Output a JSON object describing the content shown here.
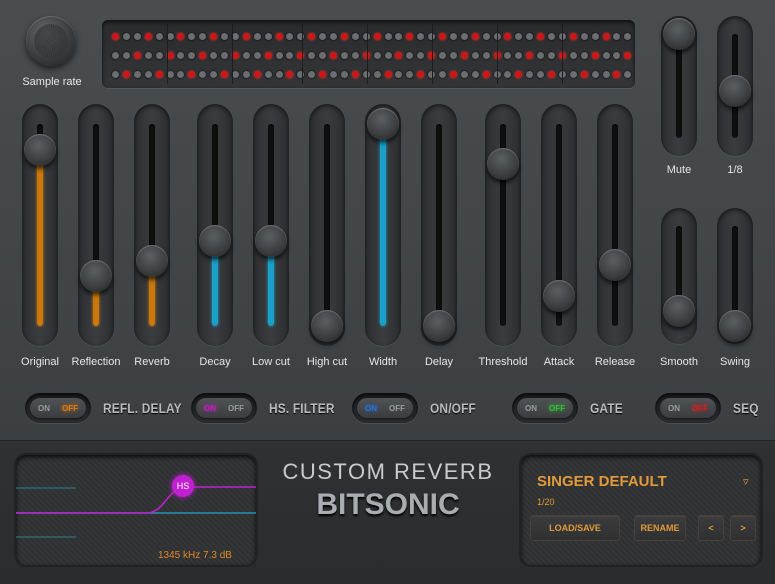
{
  "knob": {
    "label": "Sample rate"
  },
  "sliders": [
    {
      "id": "original",
      "label": "Original",
      "value": 0.87,
      "fill": "#c8780c"
    },
    {
      "id": "reflection",
      "label": "Reflection",
      "value": 0.25,
      "fill": "#c8780c"
    },
    {
      "id": "reverb",
      "label": "Reverb",
      "value": 0.32,
      "fill": "#c8780c"
    },
    {
      "id": "decay",
      "label": "Decay",
      "value": 0.42,
      "fill": "#1aa0c8"
    },
    {
      "id": "low-cut",
      "label": "Low cut",
      "value": 0.42,
      "fill": "#1aa0c8"
    },
    {
      "id": "high-cut",
      "label": "High cut",
      "value": 0.0,
      "fill": ""
    },
    {
      "id": "width",
      "label": "Width",
      "value": 1.0,
      "fill": "#1aa0c8"
    },
    {
      "id": "delay",
      "label": "Delay",
      "value": 0.0,
      "fill": ""
    },
    {
      "id": "threshold",
      "label": "Threshold",
      "value": 0.8,
      "fill": ""
    },
    {
      "id": "attack",
      "label": "Attack",
      "value": 0.15,
      "fill": ""
    },
    {
      "id": "release",
      "label": "Release",
      "value": 0.3,
      "fill": ""
    }
  ],
  "small_sliders": [
    {
      "id": "mute",
      "label": "Mute",
      "value": 1.0
    },
    {
      "id": "rate",
      "label": "1/8",
      "value": 0.45
    },
    {
      "id": "smooth",
      "label": "Smooth",
      "value": 0.15
    },
    {
      "id": "swing",
      "label": "Swing",
      "value": 0.0
    }
  ],
  "toggles": [
    {
      "id": "refl-delay",
      "on": "ON",
      "off": "OFF",
      "label": "REFL. DELAY",
      "active": "off",
      "color": "#e07a10"
    },
    {
      "id": "hs-filter",
      "on": "ON",
      "off": "OFF",
      "label": "HS. FILTER",
      "active": "on",
      "color": "#c020c0"
    },
    {
      "id": "on-off",
      "on": "ON",
      "off": "OFF",
      "label": "ON/OFF",
      "active": "on",
      "color": "#2a70d0"
    },
    {
      "id": "gate",
      "on": "ON",
      "off": "OFF",
      "label": "GATE",
      "active": "off",
      "color": "#30c030"
    },
    {
      "id": "seq",
      "on": "ON",
      "off": "OFF",
      "label": "SEQ",
      "active": "off",
      "color": "#d02020"
    }
  ],
  "filter": {
    "handle_label": "HS",
    "readout": "1345 kHz 7.3 dB",
    "curve_color": "#c020d0"
  },
  "brand": {
    "title": "CUSTOM REVERB",
    "name": "BITSONIC"
  },
  "preset": {
    "name": "SINGER DEFAULT",
    "counter": "1/20",
    "load_save": "LOAD/SAVE",
    "rename": "RENAME",
    "prev": "<",
    "next": ">",
    "dropdown": "▿"
  },
  "colors": {
    "accent": "#e39a3a",
    "led_red": "#c81818",
    "led_white": "#d8d8d8"
  }
}
